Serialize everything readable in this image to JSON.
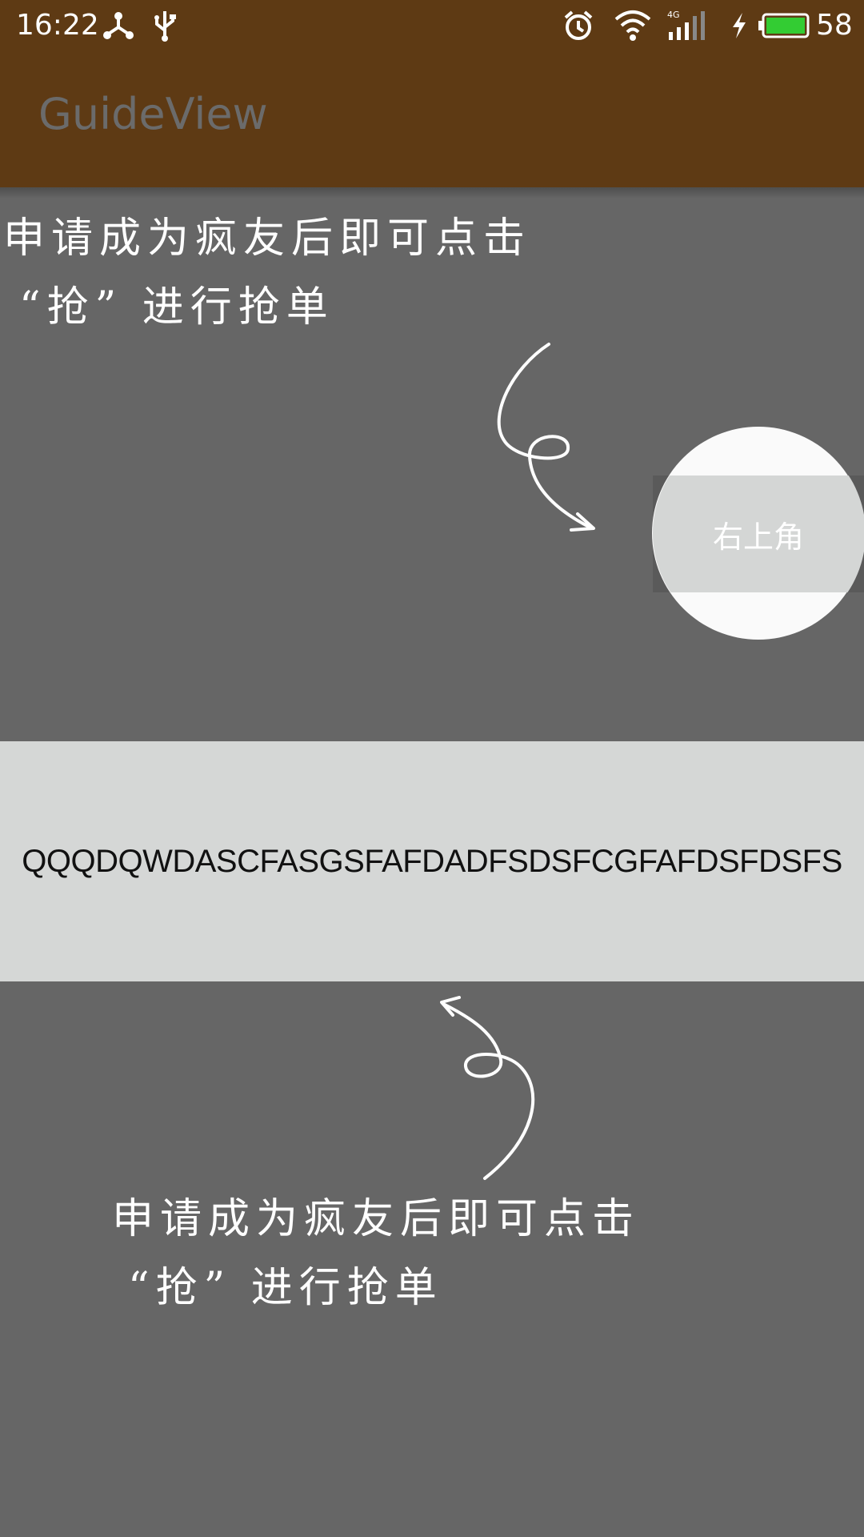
{
  "status_bar": {
    "time": "16:22",
    "battery_level": "58",
    "network": "4G",
    "icons": [
      "share-icon",
      "usb-icon",
      "alarm-icon",
      "wifi-icon",
      "signal-icon",
      "charging-icon",
      "battery-icon"
    ],
    "battery_color": "#33cc33"
  },
  "app_bar": {
    "title": "GuideView",
    "background_color": "#5e3a14"
  },
  "guide": {
    "top_text_line1": "申请成为疯友后即可点击",
    "top_text_line2": "“抢” 进行抢单",
    "bottom_text_line1": "申请成为疯友后即可点击",
    "bottom_text_line2": "“抢” 进行抢单"
  },
  "highlight": {
    "label": "右上角"
  },
  "banner": {
    "text": "QQQDQWDASCFASGSFAFDADFSDSFCGFAFDSFDSFS"
  },
  "overlay_color": "#666666"
}
